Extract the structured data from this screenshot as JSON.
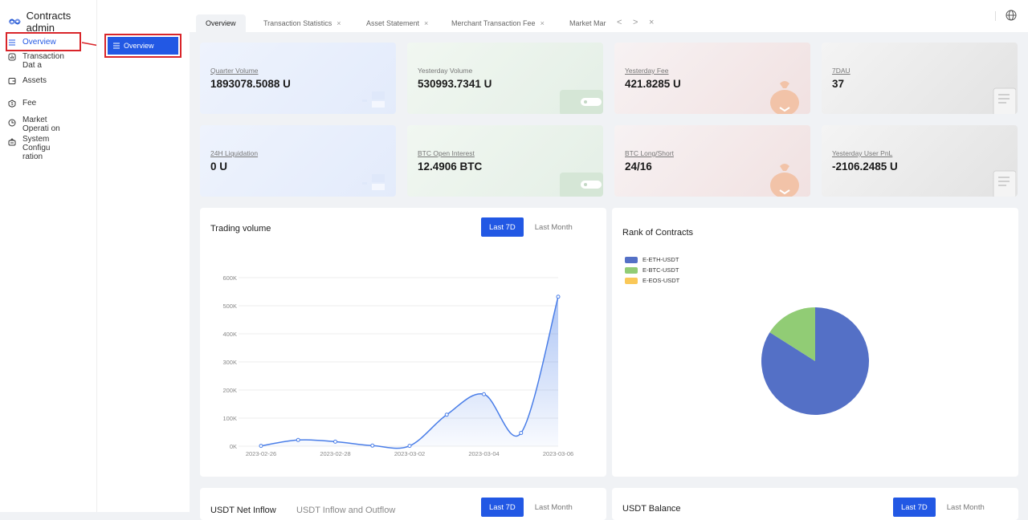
{
  "app": {
    "title": "Contracts admin"
  },
  "sidebar": {
    "items": [
      {
        "label": "Overview",
        "icon": "menu-icon",
        "active": true
      },
      {
        "label": "Transaction Dat a",
        "icon": "chart-box-icon"
      },
      {
        "label": "Assets",
        "icon": "wallet-icon"
      },
      {
        "label": "Fee",
        "icon": "coin-icon"
      },
      {
        "label": "Market Operati on",
        "icon": "clock-icon"
      },
      {
        "label": "System Configu ration",
        "icon": "settings-icon"
      }
    ],
    "submenu": {
      "label": "Overview"
    }
  },
  "tabs": [
    {
      "label": "Overview",
      "active": true
    },
    {
      "label": "Transaction Statistics",
      "closable": true
    },
    {
      "label": "Asset Statement",
      "closable": true
    },
    {
      "label": "Merchant Transaction Fee",
      "closable": true
    },
    {
      "label": "Market Mar",
      "closable": false
    }
  ],
  "tab_nav": {
    "prev": "<",
    "next": ">",
    "close": "×"
  },
  "cards": [
    {
      "label": "Quarter Volume",
      "value": "1893078.5088 U",
      "theme": "blue"
    },
    {
      "label": "Yesterday Volume",
      "value": "530993.7341 U",
      "theme": "green"
    },
    {
      "label": "Yesterday Fee",
      "value": "421.8285 U",
      "theme": "red"
    },
    {
      "label": "7DAU",
      "value": "37",
      "theme": "gray"
    },
    {
      "label": "24H Liquidation",
      "value": "0 U",
      "theme": "blue"
    },
    {
      "label": "BTC Open Interest",
      "value": "12.4906 BTC",
      "theme": "green"
    },
    {
      "label": "BTC Long/Short",
      "value": "24/16",
      "theme": "red"
    },
    {
      "label": "Yesterday User PnL",
      "value": "-2106.2485 U",
      "theme": "gray"
    }
  ],
  "trading_panel": {
    "title": "Trading volume",
    "btn_7d": "Last 7D",
    "btn_month": "Last Month"
  },
  "rank_panel": {
    "title": "Rank of Contracts"
  },
  "bottom_left": {
    "title": "USDT Net Inflow",
    "title2": "USDT Inflow and Outflow",
    "btn_7d": "Last 7D",
    "btn_month": "Last Month"
  },
  "bottom_right": {
    "title": "USDT Balance",
    "btn_7d": "Last 7D",
    "btn_month": "Last Month"
  },
  "colors": {
    "accent": "#2258e4",
    "highlight": "#d9252a",
    "line": "#4a7ee8",
    "pie_eth": "#5470c6",
    "pie_btc": "#91cc75",
    "pie_eos": "#fac858"
  },
  "chart_data": [
    {
      "type": "area",
      "title": "Trading volume",
      "x": [
        "2023-02-26",
        "2023-02-27",
        "2023-02-28",
        "2023-03-01",
        "2023-03-02",
        "2023-03-03",
        "2023-03-04",
        "2023-03-05",
        "2023-03-06"
      ],
      "x_tick_labels": [
        "2023-02-26",
        "2023-02-28",
        "2023-03-02",
        "2023-03-04",
        "2023-03-06"
      ],
      "values": [
        1000,
        22000,
        16000,
        2000,
        1000,
        112000,
        185000,
        47000,
        532000
      ],
      "y_ticks": [
        "0K",
        "100K",
        "200K",
        "300K",
        "400K",
        "500K",
        "600K"
      ],
      "ylim": [
        0,
        600000
      ],
      "grid": true
    },
    {
      "type": "pie",
      "title": "Rank of Contracts",
      "legend_position": "top-left",
      "slices": [
        {
          "name": "E-ETH-USDT",
          "value": 84
        },
        {
          "name": "E-BTC-USDT",
          "value": 16
        },
        {
          "name": "E-EOS-USDT",
          "value": 0
        }
      ]
    }
  ]
}
